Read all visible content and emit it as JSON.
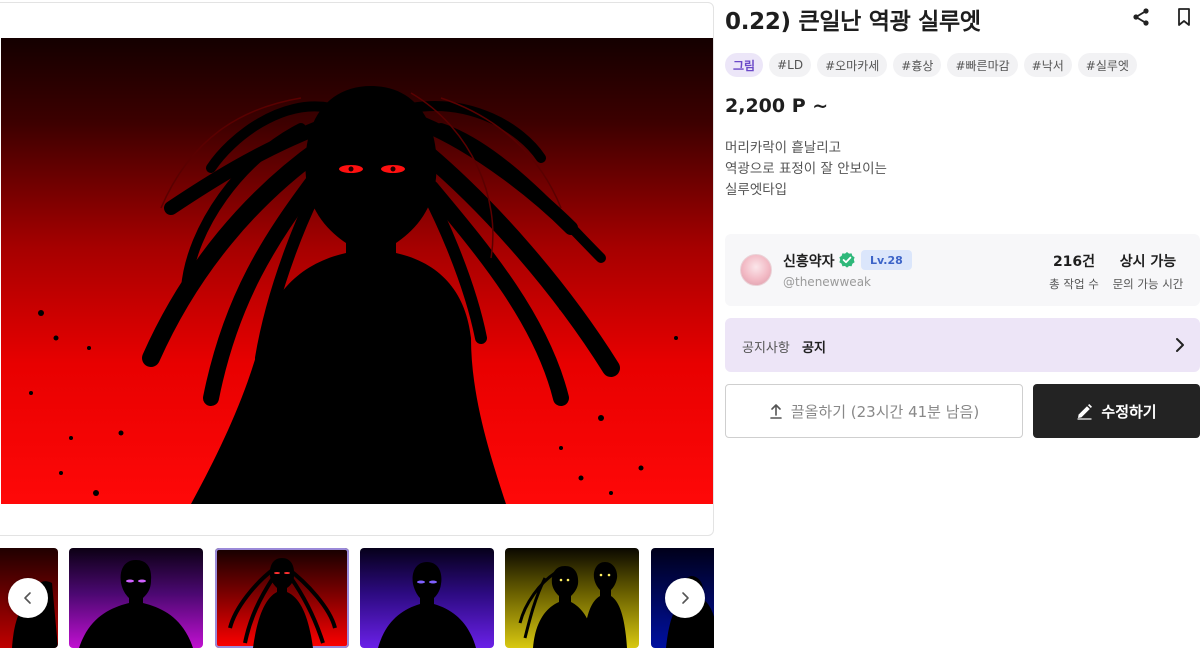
{
  "product": {
    "title": "0.22) 큰일난 역광 실루엣",
    "category_tag": "그림",
    "tags": [
      "#LD",
      "#오마카세",
      "#흉상",
      "#빠른마감",
      "#낙서",
      "#실루엣"
    ],
    "price": "2,200 P ~",
    "description": [
      "머리카락이 흩날리고",
      "역광으로 표정이 잘 안보이는",
      "실루엣타입"
    ]
  },
  "seller": {
    "name": "신흥약자",
    "level": "Lv.28",
    "handle": "@thenewweak",
    "works_count": "216건",
    "works_label": "총 작업 수",
    "contact_value": "상시 가능",
    "contact_label": "문의 가능 시간"
  },
  "notice": {
    "label": "공지사항",
    "value": "공지"
  },
  "actions": {
    "bump_label": "끌올하기 (23시간 41분 남음)",
    "edit_label": "수정하기"
  },
  "gallery": {
    "thumbnail_colors": [
      "#c00000",
      "#c010d0",
      "#ff0000",
      "#6a20e8",
      "#d8c810",
      "#0010a0"
    ],
    "selected_index": 2
  },
  "colors": {
    "accent": "#6a48c8",
    "level_badge": "#3c64c8",
    "verified": "#2fb87a",
    "notice_bg": "#ede5f7",
    "primary_button": "#232323"
  },
  "icons": {
    "share": "share-icon",
    "bookmark": "bookmark-icon",
    "verified": "verified-check-icon",
    "notice": "chevron-right-icon",
    "bump": "upload-arrow-icon",
    "edit": "pencil-icon",
    "prev": "chevron-left-icon",
    "next": "chevron-right-icon"
  }
}
